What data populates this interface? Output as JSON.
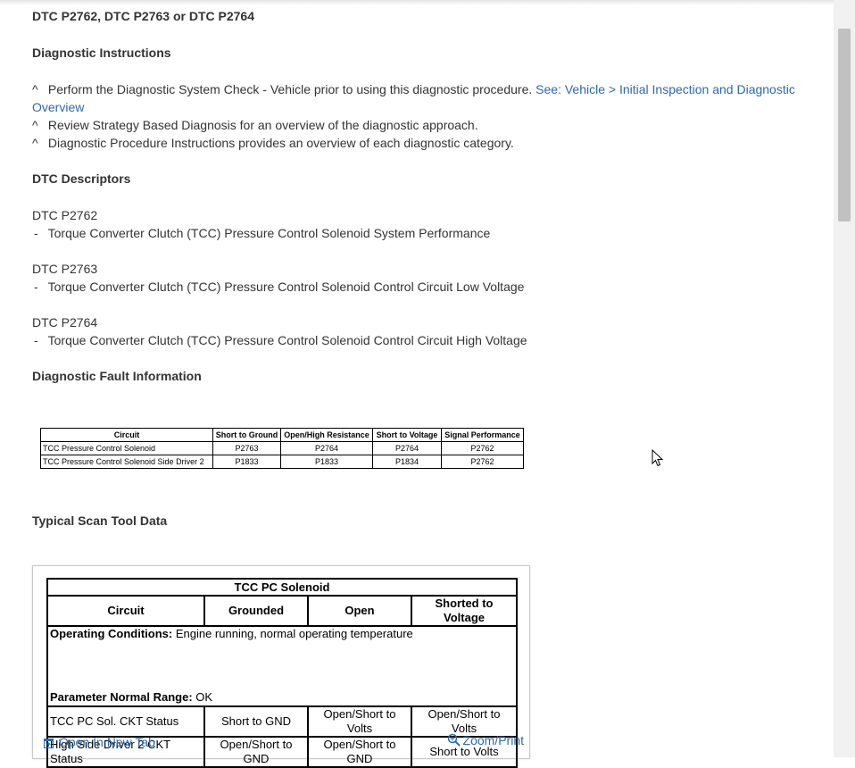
{
  "title": "DTC P2762, DTC P2763 or DTC P2764",
  "diagnostic_instructions": {
    "heading": "Diagnostic Instructions",
    "bullet_marker": "^",
    "items": [
      {
        "text": "Perform the Diagnostic System Check - Vehicle prior to using this diagnostic procedure.",
        "link_line1": "See: Vehicle > Initial Inspection and Diagnostic",
        "link_line2": "Overview"
      },
      {
        "text": "Review Strategy Based Diagnosis for an overview of the diagnostic approach."
      },
      {
        "text": "Diagnostic Procedure Instructions provides an overview of each diagnostic category."
      }
    ]
  },
  "dtc_descriptors": {
    "heading": "DTC Descriptors",
    "dash": "-",
    "items": [
      {
        "code": "DTC P2762",
        "desc": "Torque Converter Clutch (TCC) Pressure Control Solenoid System Performance"
      },
      {
        "code": "DTC P2763",
        "desc": "Torque Converter Clutch (TCC) Pressure Control Solenoid Control Circuit Low Voltage"
      },
      {
        "code": "DTC P2764",
        "desc": "Torque Converter Clutch (TCC) Pressure Control Solenoid Control Circuit High Voltage"
      }
    ]
  },
  "fault_info": {
    "heading": "Diagnostic Fault Information",
    "columns": [
      "Circuit",
      "Short to Ground",
      "Open/High Resistance",
      "Short to Voltage",
      "Signal Performance"
    ],
    "rows": [
      [
        "TCC Pressure Control Solenoid",
        "P2763",
        "P2764",
        "P2764",
        "P2762"
      ],
      [
        "TCC Pressure Control Solenoid Side Driver 2",
        "P1833",
        "P1833",
        "P1834",
        "P2762"
      ]
    ]
  },
  "scan_tool": {
    "heading": "Typical Scan Tool Data",
    "table_title": "TCC PC Solenoid",
    "columns": [
      "Circuit",
      "Grounded",
      "Open",
      "Shorted to Voltage"
    ],
    "operating_label": "Operating Conditions:",
    "operating_value": " Engine running, normal operating temperature",
    "range_label": "Parameter Normal Range:",
    "range_value": " OK",
    "rows": [
      [
        "TCC PC Sol. CKT Status",
        "Short to GND",
        "Open/Short to Volts",
        "Open/Short to Volts"
      ],
      [
        "High Side Driver 2 CKT Status",
        "Open/Short to GND",
        "Open/Short to GND",
        "Short to Volts"
      ]
    ],
    "open_tab_label": "Open In New Tab",
    "zoom_label": "Zoom/Print",
    "open_tab_icon": "new-tab-icon",
    "zoom_icon": "magnifier-icon"
  },
  "colors": {
    "link": "#2a6aae",
    "text": "#333333"
  }
}
